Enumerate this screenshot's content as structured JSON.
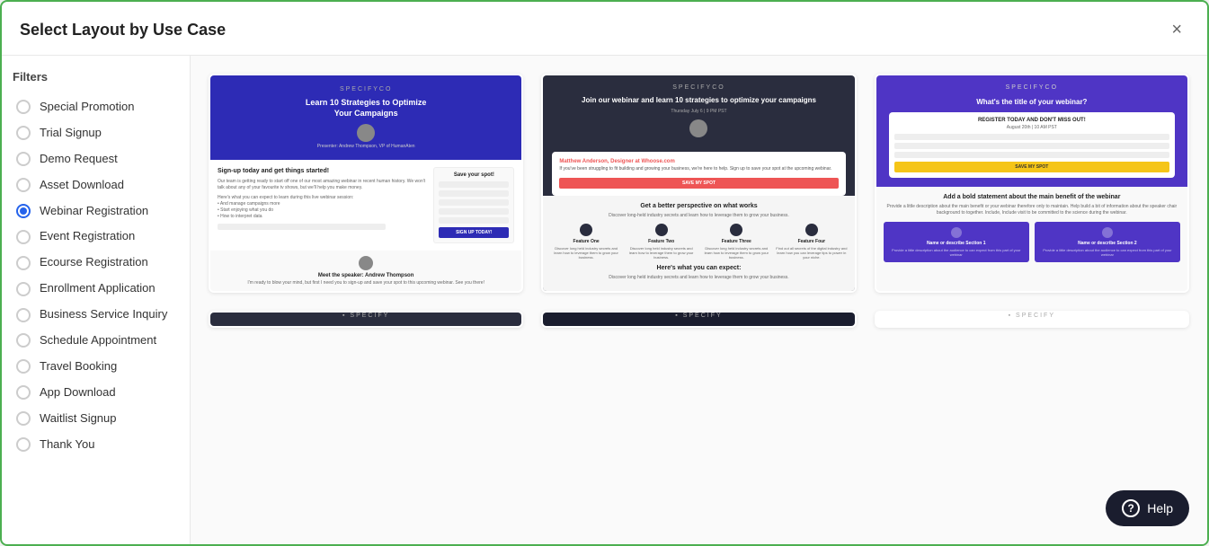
{
  "modal": {
    "title": "Select Layout by Use Case",
    "close_label": "×"
  },
  "sidebar": {
    "filters_label": "Filters",
    "items": [
      {
        "id": "special-promotion",
        "label": "Special Promotion",
        "active": false
      },
      {
        "id": "trial-signup",
        "label": "Trial Signup",
        "active": false
      },
      {
        "id": "demo-request",
        "label": "Demo Request",
        "active": false
      },
      {
        "id": "asset-download",
        "label": "Asset Download",
        "active": false
      },
      {
        "id": "webinar-registration",
        "label": "Webinar Registration",
        "active": true
      },
      {
        "id": "event-registration",
        "label": "Event Registration",
        "active": false
      },
      {
        "id": "ecourse-registration",
        "label": "Ecourse Registration",
        "active": false
      },
      {
        "id": "enrollment-application",
        "label": "Enrollment Application",
        "active": false
      },
      {
        "id": "business-service-inquiry",
        "label": "Business Service Inquiry",
        "active": false
      },
      {
        "id": "schedule-appointment",
        "label": "Schedule Appointment",
        "active": false
      },
      {
        "id": "travel-booking",
        "label": "Travel Booking",
        "active": false
      },
      {
        "id": "app-download",
        "label": "App Download",
        "active": false
      },
      {
        "id": "waitlist-signup",
        "label": "Waitlist Signup",
        "active": false
      },
      {
        "id": "thank-you",
        "label": "Thank You",
        "active": false
      }
    ]
  },
  "templates": {
    "row1": [
      {
        "id": "template-1",
        "brand": "SPECIFYCO",
        "title": "Learn 10 Strategies to Optimize Your Campaigns",
        "cta": "SIGN UP TODAY!",
        "form_title": "Save your spot!",
        "speaker_name": "Meet the speaker: Andrew Thompson"
      },
      {
        "id": "template-2",
        "brand": "SPECIFYCO",
        "title": "Join our webinar and learn 10 strategies to optimize your campaigns",
        "date": "Thursday July 6 | 9 PM PST",
        "cta": "SAVE MY SPOT",
        "section_title": "Get a better perspective on what works",
        "expects_title": "Here's what you can expect:"
      },
      {
        "id": "template-3",
        "brand": "SPECIFYCO",
        "title": "What's the title of your webinar?",
        "form_title": "REGISTER TODAY AND DON'T MISS OUT!",
        "cta": "SAVE MY SPOT",
        "section_title": "Add a bold statement about the main benefit of the webinar"
      }
    ],
    "row2": [
      {
        "id": "template-4",
        "brand": "SPECIFY"
      },
      {
        "id": "template-5",
        "brand": "SPECIFY"
      },
      {
        "id": "template-6",
        "brand": "SPECIFY"
      }
    ]
  },
  "help": {
    "label": "Help",
    "icon": "?"
  }
}
